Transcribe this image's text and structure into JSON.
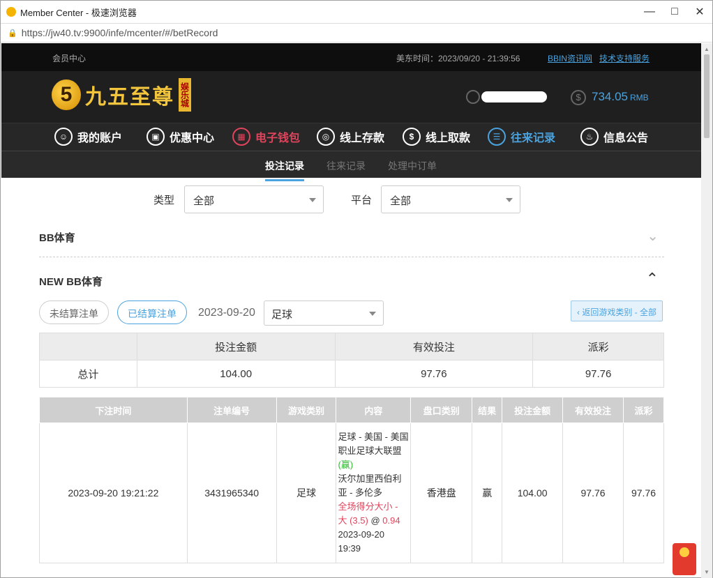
{
  "window": {
    "title": "Member Center - 极速浏览器",
    "url": "https://jw40.tv:9900/infe/mcenter/#/betRecord"
  },
  "topbar": {
    "member_center": "会员中心",
    "time_label": "美东时间：2023/09/20 - 21:39:56",
    "link_news": "BBIN资讯网",
    "link_support": "技术支持服务"
  },
  "header": {
    "logo_text": "九五至尊",
    "logo_tag": "娱乐城",
    "balance": "734.05",
    "balance_unit": "RMB"
  },
  "main_nav": [
    {
      "label": "我的账户",
      "icon": "user-icon"
    },
    {
      "label": "优惠中心",
      "icon": "gift-icon"
    },
    {
      "label": "电子钱包",
      "icon": "wallet-icon"
    },
    {
      "label": "线上存款",
      "icon": "deposit-icon"
    },
    {
      "label": "线上取款",
      "icon": "withdraw-icon"
    },
    {
      "label": "往来记录",
      "icon": "record-icon"
    },
    {
      "label": "信息公告",
      "icon": "bell-icon"
    }
  ],
  "sub_nav": [
    "投注记录",
    "往来记录",
    "处理中订单"
  ],
  "filters": {
    "type_label": "类型",
    "type_value": "全部",
    "platform_label": "平台",
    "platform_value": "全部"
  },
  "sections": {
    "bb_sports": "BB体育",
    "new_bb_sports": "NEW BB体育"
  },
  "controls": {
    "unsettled": "未结算注单",
    "settled": "已结算注单",
    "date": "2023-09-20",
    "sport_value": "足球",
    "back": "‹ 返回游戏类别 - 全部"
  },
  "summary": {
    "headers": [
      "",
      "投注金额",
      "有效投注",
      "派彩"
    ],
    "row": [
      "总计",
      "104.00",
      "97.76",
      "97.76"
    ]
  },
  "detail": {
    "headers": [
      "下注时间",
      "注单编号",
      "游戏类别",
      "内容",
      "盘口类别",
      "结果",
      "投注金额",
      "有效投注",
      "派彩"
    ],
    "row": {
      "time": "2023-09-20 19:21:22",
      "id": "3431965340",
      "category": "足球",
      "content_line1": "足球 - 美国 - 美国职业足球大联盟",
      "content_win": "(赢)",
      "content_line2": "沃尔加里西伯利亚 - 多伦多",
      "content_bet": "全场得分大小 - 大 (3.5)",
      "content_at": "@",
      "content_odds": "0.94",
      "content_time": "2023-09-20 19:39",
      "market": "香港盘",
      "result": "赢",
      "amount": "104.00",
      "valid": "97.76",
      "payout": "97.76"
    }
  }
}
